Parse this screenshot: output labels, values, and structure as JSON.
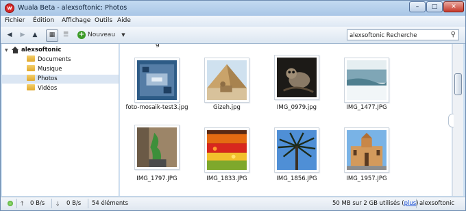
{
  "window": {
    "title": "Wuala Beta - alexsoftonic: Photos",
    "logo_letter": "w"
  },
  "menu": {
    "items": [
      "Fichier",
      "Édition",
      "Affichage",
      "Outils",
      "Aide"
    ]
  },
  "toolbar": {
    "new_label": "Nouveau"
  },
  "search": {
    "value": "alexsoftonic Recherche"
  },
  "sidebar": {
    "root": "alexsoftonic",
    "items": [
      {
        "label": "Documents"
      },
      {
        "label": "Musique"
      },
      {
        "label": "Photos",
        "selected": true
      },
      {
        "label": "Vidéos"
      }
    ]
  },
  "content": {
    "partial_label": "g",
    "files": [
      {
        "name": "foto-mosaik-test3.jpg"
      },
      {
        "name": "Gizeh.jpg"
      },
      {
        "name": "IMG_0979.jpg"
      },
      {
        "name": "IMG_1477.JPG"
      },
      {
        "name": "IMG_1797.JPG"
      },
      {
        "name": "IMG_1833.JPG"
      },
      {
        "name": "IMG_1856.JPG"
      },
      {
        "name": "IMG_1957.JPG"
      }
    ]
  },
  "status": {
    "upload_rate": "0 B/s",
    "download_rate": "0 B/s",
    "item_count": "54 éléments",
    "storage_usage": "50 MB sur 2 GB utilisés",
    "more_open": "(",
    "more_link": "plus",
    "more_close": ")",
    "username": "alexsoftonic"
  }
}
